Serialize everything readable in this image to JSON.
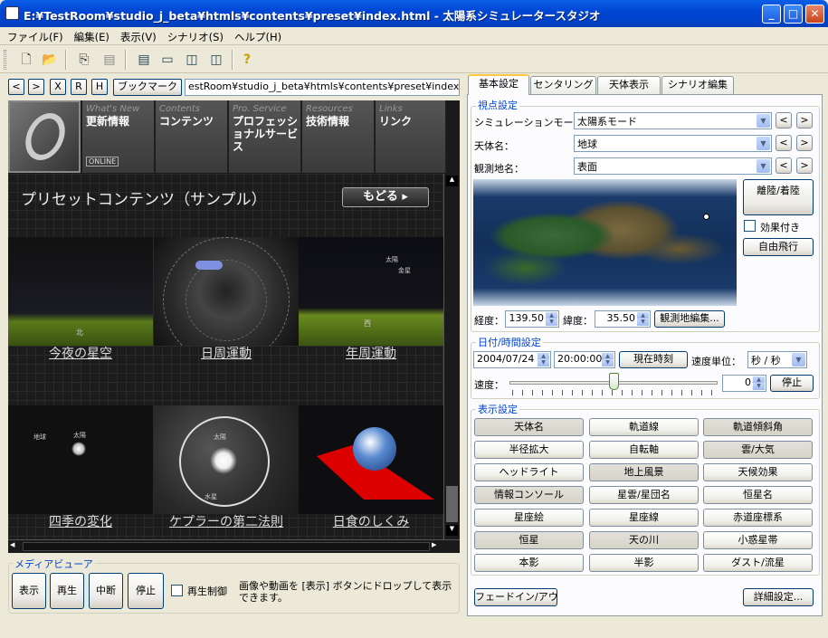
{
  "window": {
    "title": "E:¥TestRoom¥studio_j_beta¥htmls¥contents¥preset¥index.html - 太陽系シミュレータースタジオ"
  },
  "menu": [
    "ファイル(F)",
    "編集(E)",
    "表示(V)",
    "シナリオ(S)",
    "ヘルプ(H)"
  ],
  "nav": {
    "back": "<",
    "forward": ">",
    "stop": "X",
    "reload": "R",
    "home": "H",
    "bookmark": "ブックマーク",
    "address": "estRoom¥studio_j_beta¥htmls¥contents¥preset¥index.html"
  },
  "web": {
    "tiles": [
      {
        "en": "What's New",
        "jp": "更新情報",
        "badge": "ONLINE"
      },
      {
        "en": "Contents",
        "jp": "コンテンツ"
      },
      {
        "en": "Pro. Service",
        "jp": "プロフェッショナルサービス"
      },
      {
        "en": "Resources",
        "jp": "技術情報"
      },
      {
        "en": "Links",
        "jp": "リンク"
      }
    ],
    "heading": "プリセットコンテンツ（サンプル）",
    "back_button": "もどる",
    "items": [
      "今夜の星空",
      "日周運動",
      "年周運動",
      "四季の変化",
      "ケプラーの第二法則",
      "日食のしくみ"
    ],
    "thumb_labels": {
      "north": "北",
      "west": "西",
      "sun": "太陽",
      "venus": "金星",
      "earth": "地球",
      "mercury": "水星"
    }
  },
  "media": {
    "title": "メディアビューア",
    "show": "表示",
    "play": "再生",
    "pause": "中断",
    "stop": "停止",
    "play_control": "再生制御",
    "hint": "画像や動画を [表示] ボタンにドロップして表示できます。"
  },
  "tabs": [
    "基本設定",
    "センタリング",
    "天体表示",
    "シナリオ編集"
  ],
  "viewpoint": {
    "title": "視点設定",
    "mode_label": "シミュレーションモード：",
    "mode": "太陽系モード",
    "body_label": "天体名：",
    "body": "地球",
    "site_label": "観測地名：",
    "site": "表面",
    "takeoff": "離陸/着陸",
    "effect": "効果付き",
    "free_flight": "自由飛行",
    "lon_label": "経度：",
    "lon": "139.50",
    "lat_label": "緯度：",
    "lat": "35.50",
    "edit_site": "観測地編集..."
  },
  "datetime": {
    "title": "日付/時間設定",
    "date": "2004/07/24",
    "time": "20:00:00",
    "now": "現在時刻",
    "unit_label": "速度単位：",
    "unit": "秒 / 秒",
    "speed_label": "速度：",
    "speed": "0",
    "stop": "停止",
    "slider_position": 0.5
  },
  "display": {
    "title": "表示設定",
    "buttons": [
      {
        "label": "天体名",
        "on": true
      },
      {
        "label": "軌道線",
        "on": false
      },
      {
        "label": "軌道傾斜角",
        "on": true
      },
      {
        "label": "半径拡大",
        "on": false
      },
      {
        "label": "自転軸",
        "on": false
      },
      {
        "label": "雲/大気",
        "on": true
      },
      {
        "label": "ヘッドライト",
        "on": false
      },
      {
        "label": "地上風景",
        "on": true
      },
      {
        "label": "天候効果",
        "on": false
      },
      {
        "label": "情報コンソール",
        "on": true
      },
      {
        "label": "星雲/星団名",
        "on": false
      },
      {
        "label": "恒星名",
        "on": false
      },
      {
        "label": "星座絵",
        "on": false
      },
      {
        "label": "星座線",
        "on": false
      },
      {
        "label": "赤道座標系",
        "on": false
      },
      {
        "label": "恒星",
        "on": true
      },
      {
        "label": "天の川",
        "on": true
      },
      {
        "label": "小惑星帯",
        "on": false
      },
      {
        "label": "本影",
        "on": false
      },
      {
        "label": "半影",
        "on": false
      },
      {
        "label": "ダスト/流星",
        "on": false
      }
    ]
  },
  "footer": {
    "fade": "フェードイン/アウト",
    "details": "詳細設定..."
  },
  "icons": [
    "app-icon",
    "new-icon",
    "open-icon",
    "copy-icon",
    "paste-icon",
    "layout-icon",
    "help-icon",
    "minimize-icon",
    "maximize-icon",
    "close-icon",
    "prev-icon",
    "next-icon",
    "dropdown-icon"
  ]
}
